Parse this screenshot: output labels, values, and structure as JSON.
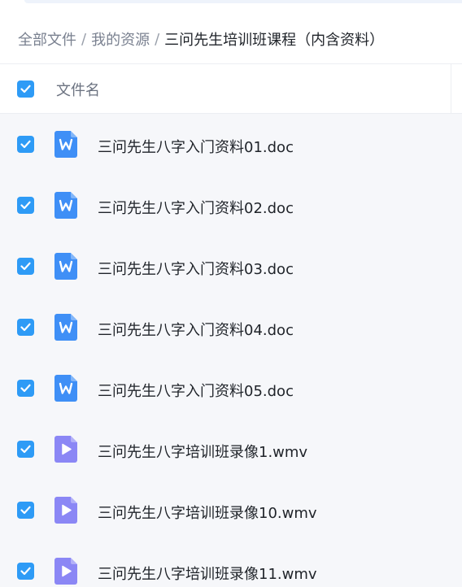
{
  "breadcrumb": {
    "root": "全部文件",
    "middle": "我的资源",
    "current": "三问先生培训班课程（内含资料）",
    "separator": "/"
  },
  "header": {
    "column_name": "文件名",
    "select_all_checked": true
  },
  "colors": {
    "accent": "#2e9bf6",
    "doc_icon": "#3f8ff6",
    "video_icon": "#8b87f5"
  },
  "files": [
    {
      "name": "三问先生八字入门资料01.doc",
      "type": "doc",
      "checked": true
    },
    {
      "name": "三问先生八字入门资料02.doc",
      "type": "doc",
      "checked": true
    },
    {
      "name": "三问先生八字入门资料03.doc",
      "type": "doc",
      "checked": true
    },
    {
      "name": "三问先生八字入门资料04.doc",
      "type": "doc",
      "checked": true
    },
    {
      "name": "三问先生八字入门资料05.doc",
      "type": "doc",
      "checked": true
    },
    {
      "name": "三问先生八字培训班录像1.wmv",
      "type": "video",
      "checked": true
    },
    {
      "name": "三问先生八字培训班录像10.wmv",
      "type": "video",
      "checked": true
    },
    {
      "name": "三问先生八字培训班录像11.wmv",
      "type": "video",
      "checked": true
    }
  ]
}
